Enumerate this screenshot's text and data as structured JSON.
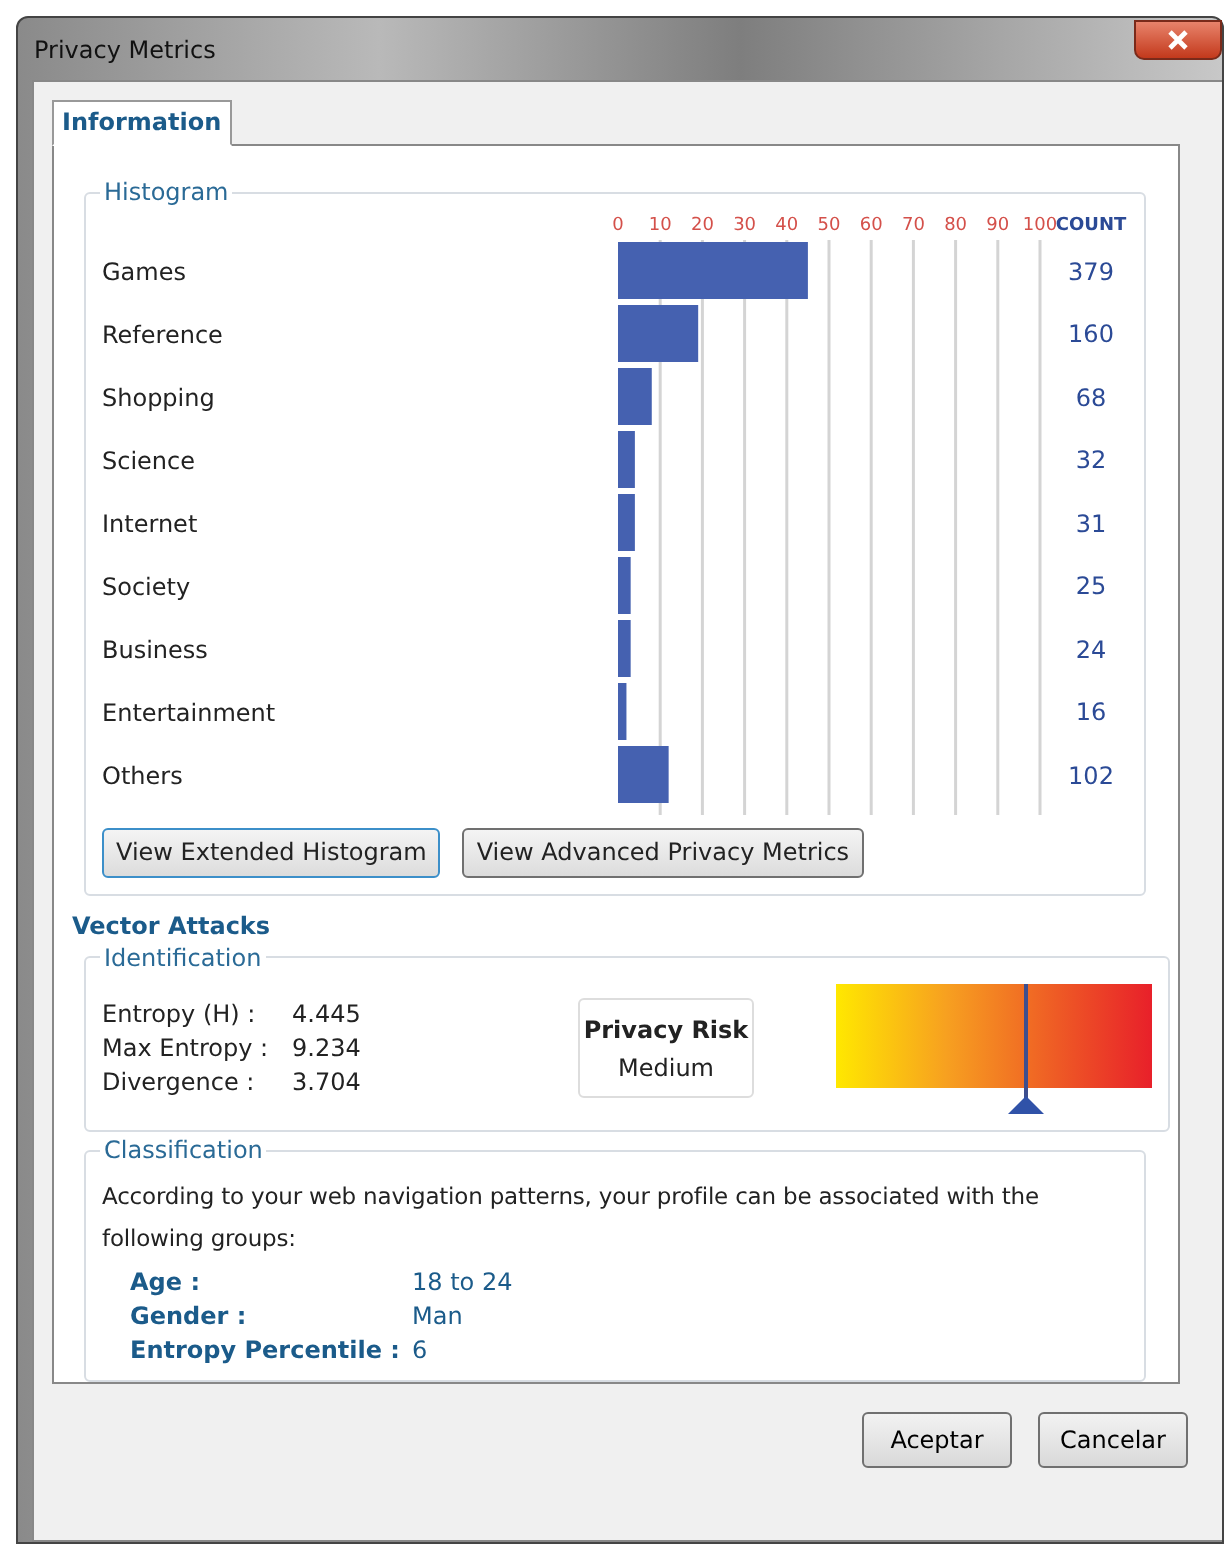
{
  "window": {
    "title": "Privacy Metrics"
  },
  "tabs": [
    {
      "label": "Information",
      "selected": true
    }
  ],
  "histogram": {
    "title": "Histogram",
    "count_header": "COUNT",
    "rows": [
      {
        "category": "Games",
        "count": "379"
      },
      {
        "category": "Reference",
        "count": "160"
      },
      {
        "category": "Shopping",
        "count": "68"
      },
      {
        "category": "Science",
        "count": "32"
      },
      {
        "category": "Internet",
        "count": "31"
      },
      {
        "category": "Society",
        "count": "25"
      },
      {
        "category": "Business",
        "count": "24"
      },
      {
        "category": "Entertainment",
        "count": "16"
      },
      {
        "category": "Others",
        "count": "102"
      }
    ],
    "chart_data": {
      "type": "bar",
      "orientation": "horizontal",
      "series": [
        {
          "color": "#4561b0",
          "values": [
            45,
            19,
            8,
            4,
            4,
            3,
            3,
            2,
            12
          ]
        }
      ],
      "xlim": [
        0,
        100
      ],
      "xticks": [
        0,
        10,
        20,
        30,
        40,
        50,
        60,
        70,
        80,
        90,
        100
      ],
      "grid": true
    },
    "buttons": [
      "View Extended Histogram",
      "View Advanced Privacy Metrics"
    ]
  },
  "vector_attacks": {
    "title": "Vector Attacks",
    "identification": {
      "title": "Identification",
      "metrics": [
        {
          "label": "Entropy (H) :",
          "value": "4.445"
        },
        {
          "label": "Max Entropy :",
          "value": "9.234"
        },
        {
          "label": "Divergence :",
          "value": "3.704"
        }
      ],
      "risk": {
        "title": "Privacy Risk",
        "value": "Medium"
      },
      "meter": {
        "level": 0.6
      }
    },
    "classification": {
      "title": "Classification",
      "text": "According to your web navigation patterns, your profile can be associated with the following groups:",
      "groups": [
        {
          "label": "Age :",
          "value": "18 to 24"
        },
        {
          "label": "Gender :",
          "value": "Man"
        },
        {
          "label": "Entropy Percentile :",
          "value": "6"
        }
      ]
    }
  },
  "buttons": [
    "Aceptar",
    "Cancelar"
  ]
}
